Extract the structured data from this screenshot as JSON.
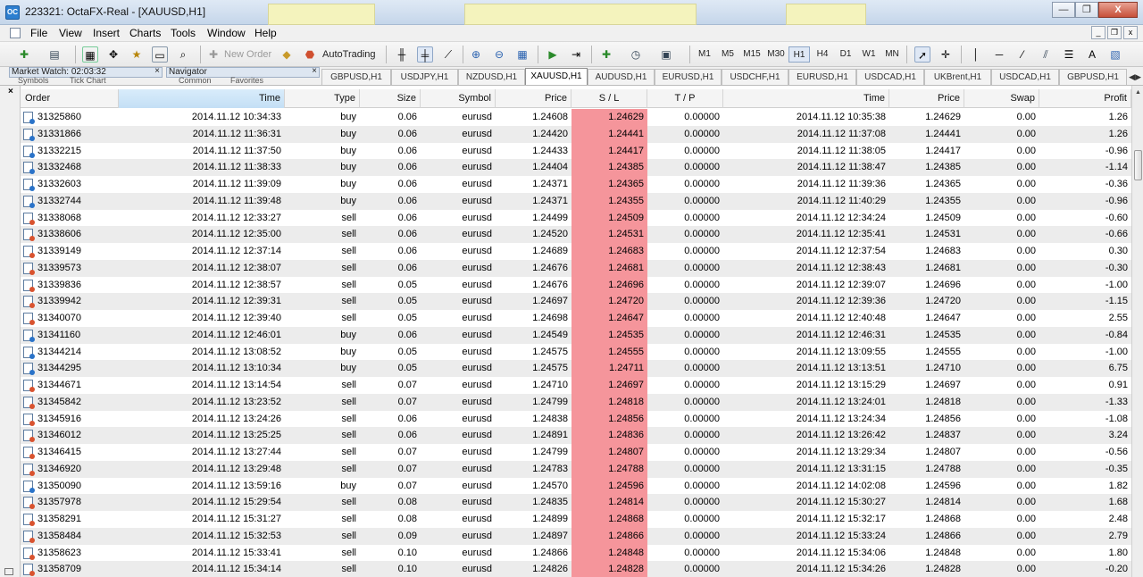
{
  "window": {
    "title": "223321: OctaFX-Real - [XAUUSD,H1]",
    "app_icon": "OC",
    "min": "—",
    "max": "❐",
    "close": "X"
  },
  "menu": {
    "items": [
      "File",
      "View",
      "Insert",
      "Charts",
      "Tools",
      "Window",
      "Help"
    ],
    "mdi": [
      "_",
      "❐",
      "x"
    ]
  },
  "toolbar": {
    "new_order": "New Order",
    "autotrading": "AutoTrading",
    "timeframes": [
      "M1",
      "M5",
      "M15",
      "M30",
      "H1",
      "H4",
      "D1",
      "W1",
      "MN"
    ],
    "active_timeframe": "H1"
  },
  "panels": {
    "market_watch": "Market Watch: 02:03:32",
    "navigator": "Navigator",
    "close": "×",
    "mw_subtabs": [
      "Symbols",
      "Tick Chart"
    ],
    "nav_subtabs": [
      "Common",
      "Favorites"
    ]
  },
  "chart_tabs": [
    "GBPUSD,H1",
    "USDJPY,H1",
    "NZDUSD,H1",
    "XAUUSD,H1",
    "AUDUSD,H1",
    "EURUSD,H1",
    "USDCHF,H1",
    "EURUSD,H1",
    "USDCAD,H1",
    "UKBrent,H1",
    "USDCAD,H1",
    "GBPUSD,H1"
  ],
  "active_chart_tab": "XAUUSD,H1",
  "terminal": {
    "close": "×",
    "columns": [
      "Order",
      "Time",
      "Type",
      "Size",
      "Symbol",
      "Price",
      "S / L",
      "T / P",
      "Time",
      "Price",
      "Swap",
      "Profit"
    ],
    "sort_indicator": "/",
    "rows": [
      [
        "31325860",
        "2014.11.12 10:34:33",
        "buy",
        "0.06",
        "eurusd",
        "1.24608",
        "1.24629",
        "0.00000",
        "2014.11.12 10:35:38",
        "1.24629",
        "0.00",
        "1.26"
      ],
      [
        "31331866",
        "2014.11.12 11:36:31",
        "buy",
        "0.06",
        "eurusd",
        "1.24420",
        "1.24441",
        "0.00000",
        "2014.11.12 11:37:08",
        "1.24441",
        "0.00",
        "1.26"
      ],
      [
        "31332215",
        "2014.11.12 11:37:50",
        "buy",
        "0.06",
        "eurusd",
        "1.24433",
        "1.24417",
        "0.00000",
        "2014.11.12 11:38:05",
        "1.24417",
        "0.00",
        "-0.96"
      ],
      [
        "31332468",
        "2014.11.12 11:38:33",
        "buy",
        "0.06",
        "eurusd",
        "1.24404",
        "1.24385",
        "0.00000",
        "2014.11.12 11:38:47",
        "1.24385",
        "0.00",
        "-1.14"
      ],
      [
        "31332603",
        "2014.11.12 11:39:09",
        "buy",
        "0.06",
        "eurusd",
        "1.24371",
        "1.24365",
        "0.00000",
        "2014.11.12 11:39:36",
        "1.24365",
        "0.00",
        "-0.36"
      ],
      [
        "31332744",
        "2014.11.12 11:39:48",
        "buy",
        "0.06",
        "eurusd",
        "1.24371",
        "1.24355",
        "0.00000",
        "2014.11.12 11:40:29",
        "1.24355",
        "0.00",
        "-0.96"
      ],
      [
        "31338068",
        "2014.11.12 12:33:27",
        "sell",
        "0.06",
        "eurusd",
        "1.24499",
        "1.24509",
        "0.00000",
        "2014.11.12 12:34:24",
        "1.24509",
        "0.00",
        "-0.60"
      ],
      [
        "31338606",
        "2014.11.12 12:35:00",
        "sell",
        "0.06",
        "eurusd",
        "1.24520",
        "1.24531",
        "0.00000",
        "2014.11.12 12:35:41",
        "1.24531",
        "0.00",
        "-0.66"
      ],
      [
        "31339149",
        "2014.11.12 12:37:14",
        "sell",
        "0.06",
        "eurusd",
        "1.24689",
        "1.24683",
        "0.00000",
        "2014.11.12 12:37:54",
        "1.24683",
        "0.00",
        "0.30"
      ],
      [
        "31339573",
        "2014.11.12 12:38:07",
        "sell",
        "0.06",
        "eurusd",
        "1.24676",
        "1.24681",
        "0.00000",
        "2014.11.12 12:38:43",
        "1.24681",
        "0.00",
        "-0.30"
      ],
      [
        "31339836",
        "2014.11.12 12:38:57",
        "sell",
        "0.05",
        "eurusd",
        "1.24676",
        "1.24696",
        "0.00000",
        "2014.11.12 12:39:07",
        "1.24696",
        "0.00",
        "-1.00"
      ],
      [
        "31339942",
        "2014.11.12 12:39:31",
        "sell",
        "0.05",
        "eurusd",
        "1.24697",
        "1.24720",
        "0.00000",
        "2014.11.12 12:39:36",
        "1.24720",
        "0.00",
        "-1.15"
      ],
      [
        "31340070",
        "2014.11.12 12:39:40",
        "sell",
        "0.05",
        "eurusd",
        "1.24698",
        "1.24647",
        "0.00000",
        "2014.11.12 12:40:48",
        "1.24647",
        "0.00",
        "2.55"
      ],
      [
        "31341160",
        "2014.11.12 12:46:01",
        "buy",
        "0.06",
        "eurusd",
        "1.24549",
        "1.24535",
        "0.00000",
        "2014.11.12 12:46:31",
        "1.24535",
        "0.00",
        "-0.84"
      ],
      [
        "31344214",
        "2014.11.12 13:08:52",
        "buy",
        "0.05",
        "eurusd",
        "1.24575",
        "1.24555",
        "0.00000",
        "2014.11.12 13:09:55",
        "1.24555",
        "0.00",
        "-1.00"
      ],
      [
        "31344295",
        "2014.11.12 13:10:34",
        "buy",
        "0.05",
        "eurusd",
        "1.24575",
        "1.24711",
        "0.00000",
        "2014.11.12 13:13:51",
        "1.24710",
        "0.00",
        "6.75"
      ],
      [
        "31344671",
        "2014.11.12 13:14:54",
        "sell",
        "0.07",
        "eurusd",
        "1.24710",
        "1.24697",
        "0.00000",
        "2014.11.12 13:15:29",
        "1.24697",
        "0.00",
        "0.91"
      ],
      [
        "31345842",
        "2014.11.12 13:23:52",
        "sell",
        "0.07",
        "eurusd",
        "1.24799",
        "1.24818",
        "0.00000",
        "2014.11.12 13:24:01",
        "1.24818",
        "0.00",
        "-1.33"
      ],
      [
        "31345916",
        "2014.11.12 13:24:26",
        "sell",
        "0.06",
        "eurusd",
        "1.24838",
        "1.24856",
        "0.00000",
        "2014.11.12 13:24:34",
        "1.24856",
        "0.00",
        "-1.08"
      ],
      [
        "31346012",
        "2014.11.12 13:25:25",
        "sell",
        "0.06",
        "eurusd",
        "1.24891",
        "1.24836",
        "0.00000",
        "2014.11.12 13:26:42",
        "1.24837",
        "0.00",
        "3.24"
      ],
      [
        "31346415",
        "2014.11.12 13:27:44",
        "sell",
        "0.07",
        "eurusd",
        "1.24799",
        "1.24807",
        "0.00000",
        "2014.11.12 13:29:34",
        "1.24807",
        "0.00",
        "-0.56"
      ],
      [
        "31346920",
        "2014.11.12 13:29:48",
        "sell",
        "0.07",
        "eurusd",
        "1.24783",
        "1.24788",
        "0.00000",
        "2014.11.12 13:31:15",
        "1.24788",
        "0.00",
        "-0.35"
      ],
      [
        "31350090",
        "2014.11.12 13:59:16",
        "buy",
        "0.07",
        "eurusd",
        "1.24570",
        "1.24596",
        "0.00000",
        "2014.11.12 14:02:08",
        "1.24596",
        "0.00",
        "1.82"
      ],
      [
        "31357978",
        "2014.11.12 15:29:54",
        "sell",
        "0.08",
        "eurusd",
        "1.24835",
        "1.24814",
        "0.00000",
        "2014.11.12 15:30:27",
        "1.24814",
        "0.00",
        "1.68"
      ],
      [
        "31358291",
        "2014.11.12 15:31:27",
        "sell",
        "0.08",
        "eurusd",
        "1.24899",
        "1.24868",
        "0.00000",
        "2014.11.12 15:32:17",
        "1.24868",
        "0.00",
        "2.48"
      ],
      [
        "31358484",
        "2014.11.12 15:32:53",
        "sell",
        "0.09",
        "eurusd",
        "1.24897",
        "1.24866",
        "0.00000",
        "2014.11.12 15:33:24",
        "1.24866",
        "0.00",
        "2.79"
      ],
      [
        "31358623",
        "2014.11.12 15:33:41",
        "sell",
        "0.10",
        "eurusd",
        "1.24866",
        "1.24848",
        "0.00000",
        "2014.11.12 15:34:06",
        "1.24848",
        "0.00",
        "1.80"
      ],
      [
        "31358709",
        "2014.11.12 15:34:14",
        "sell",
        "0.10",
        "eurusd",
        "1.24826",
        "1.24828",
        "0.00000",
        "2014.11.12 15:34:26",
        "1.24828",
        "0.00",
        "-0.20"
      ]
    ]
  },
  "colors": {
    "sl_cell": "#f5959b",
    "sorted_header": "#c4dff5",
    "alt_row": "#ececec"
  }
}
